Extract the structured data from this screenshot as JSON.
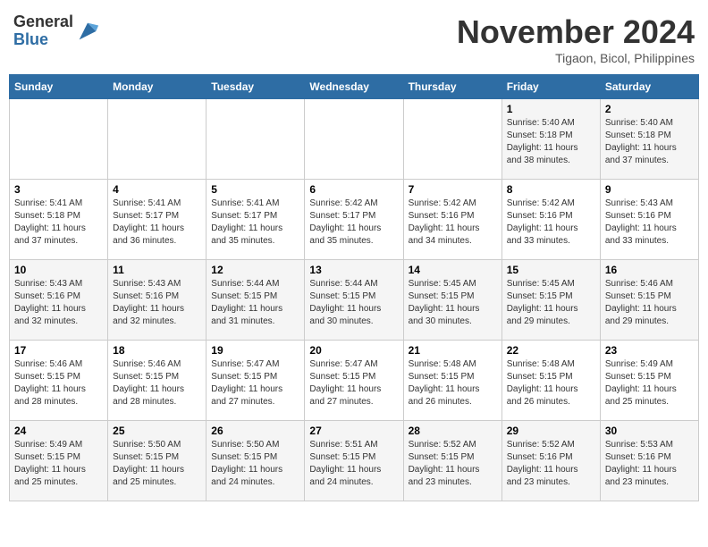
{
  "header": {
    "logo_general": "General",
    "logo_blue": "Blue",
    "month_title": "November 2024",
    "location": "Tigaon, Bicol, Philippines"
  },
  "days_of_week": [
    "Sunday",
    "Monday",
    "Tuesday",
    "Wednesday",
    "Thursday",
    "Friday",
    "Saturday"
  ],
  "weeks": [
    [
      {
        "day": "",
        "info": ""
      },
      {
        "day": "",
        "info": ""
      },
      {
        "day": "",
        "info": ""
      },
      {
        "day": "",
        "info": ""
      },
      {
        "day": "",
        "info": ""
      },
      {
        "day": "1",
        "info": "Sunrise: 5:40 AM\nSunset: 5:18 PM\nDaylight: 11 hours and 38 minutes."
      },
      {
        "day": "2",
        "info": "Sunrise: 5:40 AM\nSunset: 5:18 PM\nDaylight: 11 hours and 37 minutes."
      }
    ],
    [
      {
        "day": "3",
        "info": "Sunrise: 5:41 AM\nSunset: 5:18 PM\nDaylight: 11 hours and 37 minutes."
      },
      {
        "day": "4",
        "info": "Sunrise: 5:41 AM\nSunset: 5:17 PM\nDaylight: 11 hours and 36 minutes."
      },
      {
        "day": "5",
        "info": "Sunrise: 5:41 AM\nSunset: 5:17 PM\nDaylight: 11 hours and 35 minutes."
      },
      {
        "day": "6",
        "info": "Sunrise: 5:42 AM\nSunset: 5:17 PM\nDaylight: 11 hours and 35 minutes."
      },
      {
        "day": "7",
        "info": "Sunrise: 5:42 AM\nSunset: 5:16 PM\nDaylight: 11 hours and 34 minutes."
      },
      {
        "day": "8",
        "info": "Sunrise: 5:42 AM\nSunset: 5:16 PM\nDaylight: 11 hours and 33 minutes."
      },
      {
        "day": "9",
        "info": "Sunrise: 5:43 AM\nSunset: 5:16 PM\nDaylight: 11 hours and 33 minutes."
      }
    ],
    [
      {
        "day": "10",
        "info": "Sunrise: 5:43 AM\nSunset: 5:16 PM\nDaylight: 11 hours and 32 minutes."
      },
      {
        "day": "11",
        "info": "Sunrise: 5:43 AM\nSunset: 5:16 PM\nDaylight: 11 hours and 32 minutes."
      },
      {
        "day": "12",
        "info": "Sunrise: 5:44 AM\nSunset: 5:15 PM\nDaylight: 11 hours and 31 minutes."
      },
      {
        "day": "13",
        "info": "Sunrise: 5:44 AM\nSunset: 5:15 PM\nDaylight: 11 hours and 30 minutes."
      },
      {
        "day": "14",
        "info": "Sunrise: 5:45 AM\nSunset: 5:15 PM\nDaylight: 11 hours and 30 minutes."
      },
      {
        "day": "15",
        "info": "Sunrise: 5:45 AM\nSunset: 5:15 PM\nDaylight: 11 hours and 29 minutes."
      },
      {
        "day": "16",
        "info": "Sunrise: 5:46 AM\nSunset: 5:15 PM\nDaylight: 11 hours and 29 minutes."
      }
    ],
    [
      {
        "day": "17",
        "info": "Sunrise: 5:46 AM\nSunset: 5:15 PM\nDaylight: 11 hours and 28 minutes."
      },
      {
        "day": "18",
        "info": "Sunrise: 5:46 AM\nSunset: 5:15 PM\nDaylight: 11 hours and 28 minutes."
      },
      {
        "day": "19",
        "info": "Sunrise: 5:47 AM\nSunset: 5:15 PM\nDaylight: 11 hours and 27 minutes."
      },
      {
        "day": "20",
        "info": "Sunrise: 5:47 AM\nSunset: 5:15 PM\nDaylight: 11 hours and 27 minutes."
      },
      {
        "day": "21",
        "info": "Sunrise: 5:48 AM\nSunset: 5:15 PM\nDaylight: 11 hours and 26 minutes."
      },
      {
        "day": "22",
        "info": "Sunrise: 5:48 AM\nSunset: 5:15 PM\nDaylight: 11 hours and 26 minutes."
      },
      {
        "day": "23",
        "info": "Sunrise: 5:49 AM\nSunset: 5:15 PM\nDaylight: 11 hours and 25 minutes."
      }
    ],
    [
      {
        "day": "24",
        "info": "Sunrise: 5:49 AM\nSunset: 5:15 PM\nDaylight: 11 hours and 25 minutes."
      },
      {
        "day": "25",
        "info": "Sunrise: 5:50 AM\nSunset: 5:15 PM\nDaylight: 11 hours and 25 minutes."
      },
      {
        "day": "26",
        "info": "Sunrise: 5:50 AM\nSunset: 5:15 PM\nDaylight: 11 hours and 24 minutes."
      },
      {
        "day": "27",
        "info": "Sunrise: 5:51 AM\nSunset: 5:15 PM\nDaylight: 11 hours and 24 minutes."
      },
      {
        "day": "28",
        "info": "Sunrise: 5:52 AM\nSunset: 5:15 PM\nDaylight: 11 hours and 23 minutes."
      },
      {
        "day": "29",
        "info": "Sunrise: 5:52 AM\nSunset: 5:16 PM\nDaylight: 11 hours and 23 minutes."
      },
      {
        "day": "30",
        "info": "Sunrise: 5:53 AM\nSunset: 5:16 PM\nDaylight: 11 hours and 23 minutes."
      }
    ]
  ]
}
